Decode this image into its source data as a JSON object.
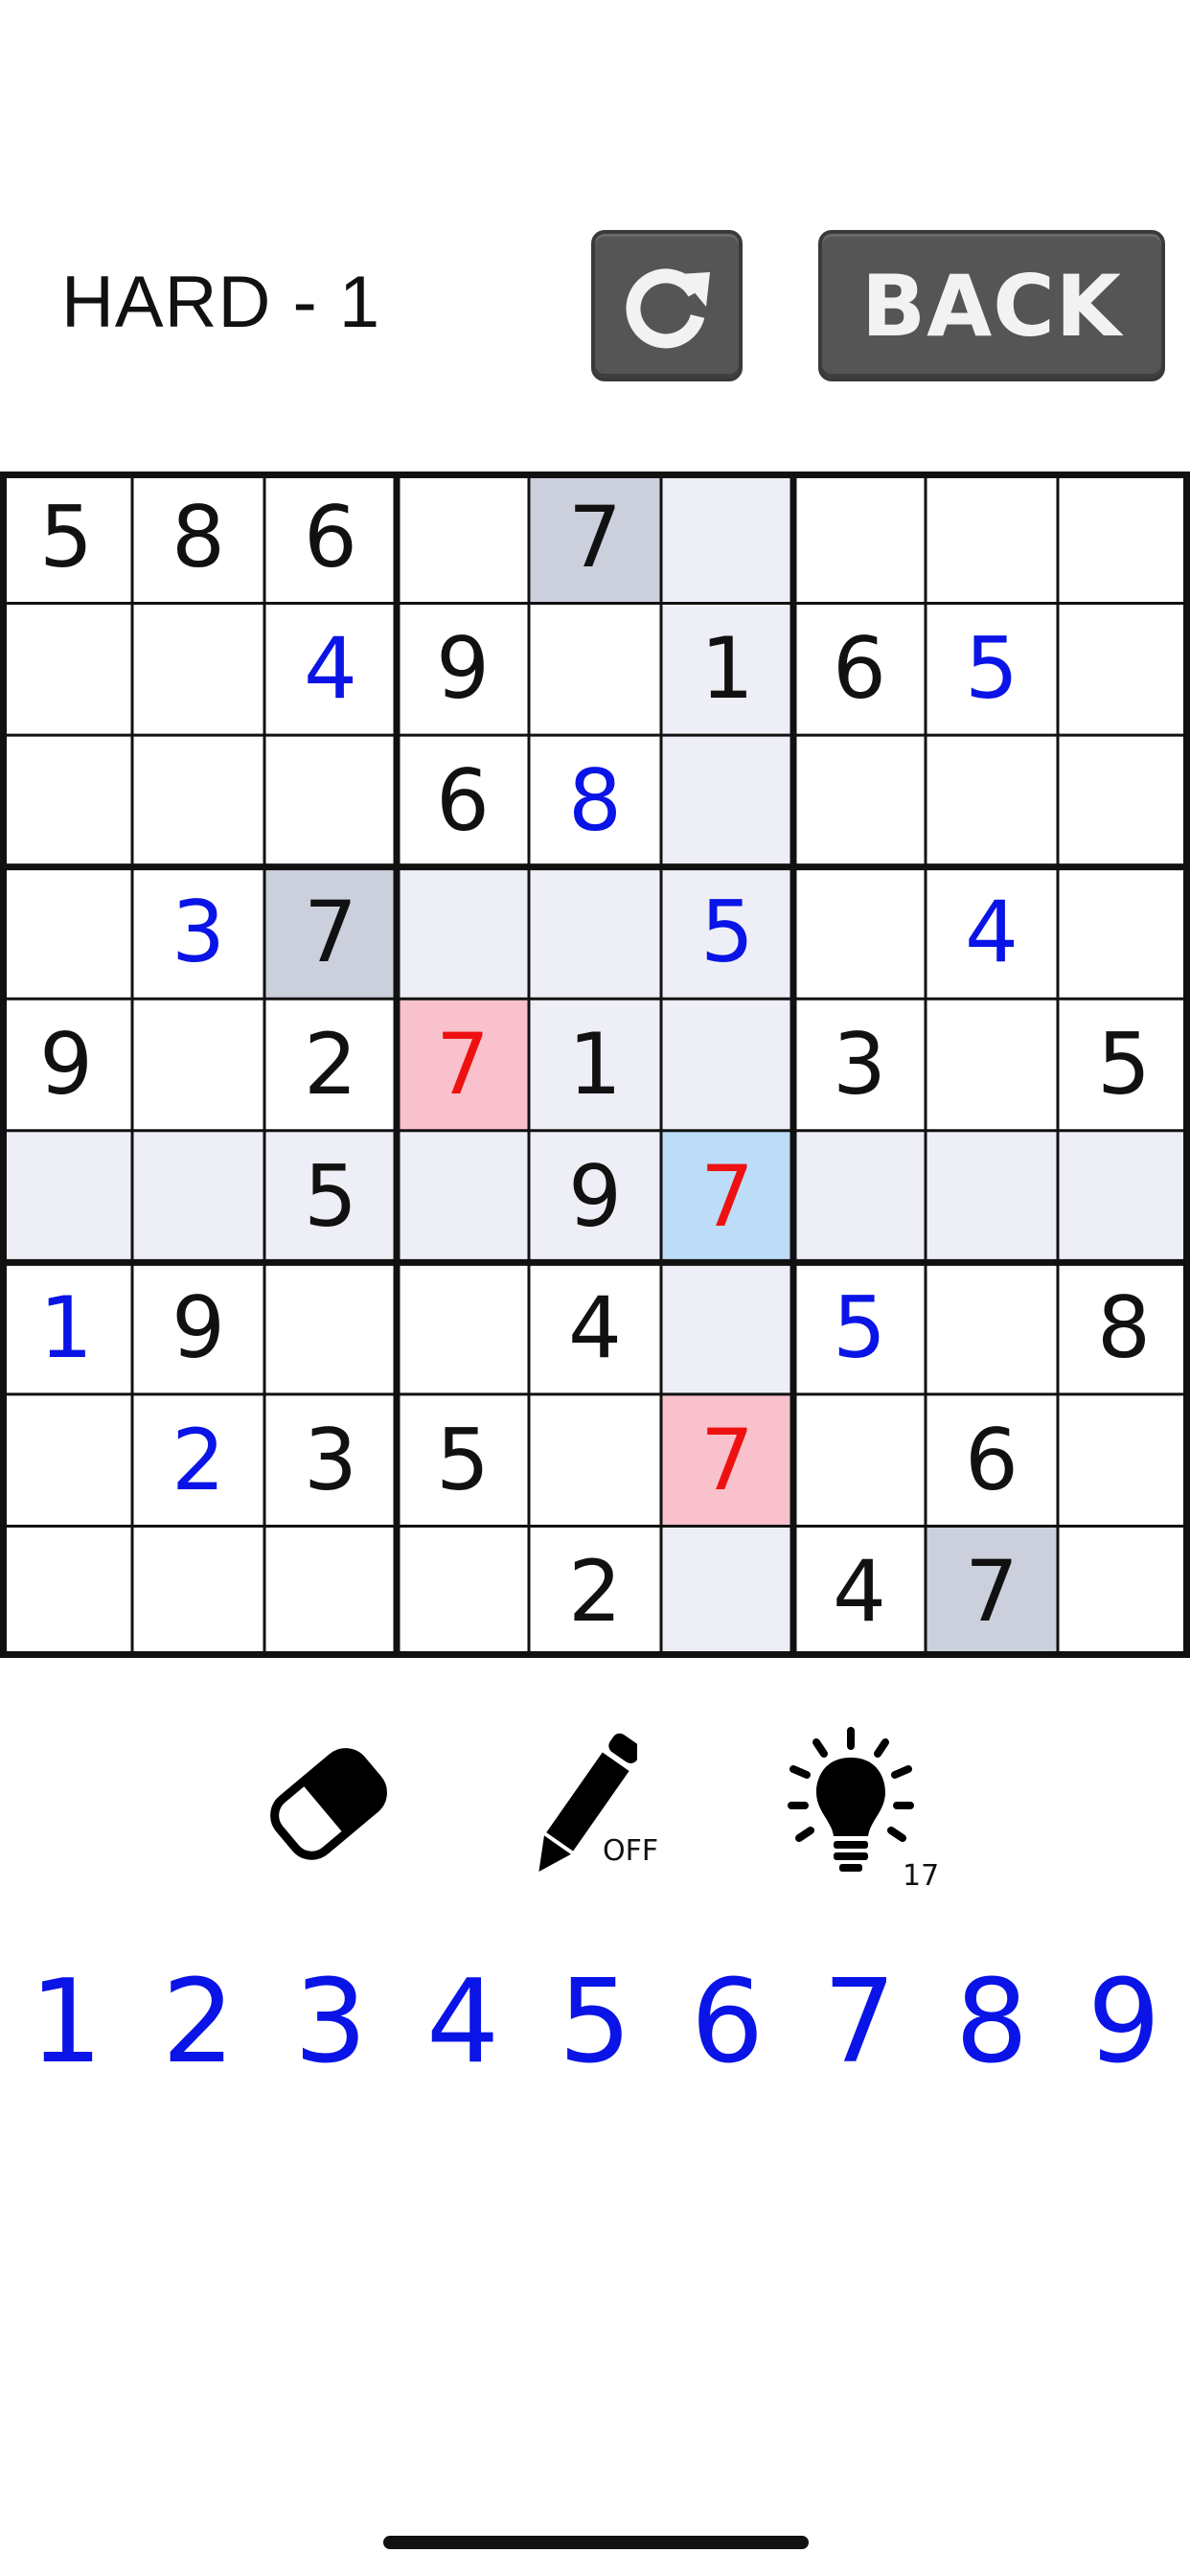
{
  "header": {
    "title": "HARD - 1",
    "back_label": "BACK",
    "reset_icon": "refresh-icon"
  },
  "colors": {
    "given": "#111111",
    "entered": "#0a14e6",
    "error": "#ee1111",
    "numpad": "#0a14e6",
    "highlight_line": "#eeeff6",
    "highlight_same": "#ccd0dc",
    "highlight_error": "#f9c1cc",
    "highlight_selected": "#bcdcf8",
    "button": "#555555"
  },
  "board": {
    "selected": [
      5,
      5
    ],
    "cells": [
      [
        {
          "v": "5",
          "t": "given"
        },
        {
          "v": "8",
          "t": "given"
        },
        {
          "v": "6",
          "t": "given"
        },
        {
          "v": "",
          "t": ""
        },
        {
          "v": "7",
          "t": "given"
        },
        {
          "v": "",
          "t": ""
        },
        {
          "v": "",
          "t": ""
        },
        {
          "v": "",
          "t": ""
        },
        {
          "v": "",
          "t": ""
        }
      ],
      [
        {
          "v": "",
          "t": ""
        },
        {
          "v": "",
          "t": ""
        },
        {
          "v": "4",
          "t": "entered"
        },
        {
          "v": "9",
          "t": "given"
        },
        {
          "v": "",
          "t": ""
        },
        {
          "v": "1",
          "t": "given"
        },
        {
          "v": "6",
          "t": "given"
        },
        {
          "v": "5",
          "t": "entered"
        },
        {
          "v": "",
          "t": ""
        }
      ],
      [
        {
          "v": "",
          "t": ""
        },
        {
          "v": "",
          "t": ""
        },
        {
          "v": "",
          "t": ""
        },
        {
          "v": "6",
          "t": "given"
        },
        {
          "v": "8",
          "t": "entered"
        },
        {
          "v": "",
          "t": ""
        },
        {
          "v": "",
          "t": ""
        },
        {
          "v": "",
          "t": ""
        },
        {
          "v": "",
          "t": ""
        }
      ],
      [
        {
          "v": "",
          "t": ""
        },
        {
          "v": "3",
          "t": "entered"
        },
        {
          "v": "7",
          "t": "given"
        },
        {
          "v": "",
          "t": ""
        },
        {
          "v": "",
          "t": ""
        },
        {
          "v": "5",
          "t": "entered"
        },
        {
          "v": "",
          "t": ""
        },
        {
          "v": "4",
          "t": "entered"
        },
        {
          "v": "",
          "t": ""
        }
      ],
      [
        {
          "v": "9",
          "t": "given"
        },
        {
          "v": "",
          "t": ""
        },
        {
          "v": "2",
          "t": "given"
        },
        {
          "v": "7",
          "t": "error"
        },
        {
          "v": "1",
          "t": "given"
        },
        {
          "v": "",
          "t": ""
        },
        {
          "v": "3",
          "t": "given"
        },
        {
          "v": "",
          "t": ""
        },
        {
          "v": "5",
          "t": "given"
        }
      ],
      [
        {
          "v": "",
          "t": ""
        },
        {
          "v": "",
          "t": ""
        },
        {
          "v": "5",
          "t": "given"
        },
        {
          "v": "",
          "t": ""
        },
        {
          "v": "9",
          "t": "given"
        },
        {
          "v": "7",
          "t": "error"
        },
        {
          "v": "",
          "t": ""
        },
        {
          "v": "",
          "t": ""
        },
        {
          "v": "",
          "t": ""
        }
      ],
      [
        {
          "v": "1",
          "t": "entered"
        },
        {
          "v": "9",
          "t": "given"
        },
        {
          "v": "",
          "t": ""
        },
        {
          "v": "",
          "t": ""
        },
        {
          "v": "4",
          "t": "given"
        },
        {
          "v": "",
          "t": ""
        },
        {
          "v": "5",
          "t": "entered"
        },
        {
          "v": "",
          "t": ""
        },
        {
          "v": "8",
          "t": "given"
        }
      ],
      [
        {
          "v": "",
          "t": ""
        },
        {
          "v": "2",
          "t": "entered"
        },
        {
          "v": "3",
          "t": "given"
        },
        {
          "v": "5",
          "t": "given"
        },
        {
          "v": "",
          "t": ""
        },
        {
          "v": "7",
          "t": "error"
        },
        {
          "v": "",
          "t": ""
        },
        {
          "v": "6",
          "t": "given"
        },
        {
          "v": "",
          "t": ""
        }
      ],
      [
        {
          "v": "",
          "t": ""
        },
        {
          "v": "",
          "t": ""
        },
        {
          "v": "",
          "t": ""
        },
        {
          "v": "",
          "t": ""
        },
        {
          "v": "2",
          "t": "given"
        },
        {
          "v": "",
          "t": ""
        },
        {
          "v": "4",
          "t": "given"
        },
        {
          "v": "7",
          "t": "given"
        },
        {
          "v": "",
          "t": ""
        }
      ]
    ],
    "highlights": {
      "same": [
        [
          0,
          4
        ],
        [
          3,
          2
        ],
        [
          8,
          7
        ]
      ],
      "error": [
        [
          4,
          3
        ],
        [
          7,
          5
        ]
      ]
    }
  },
  "tools": {
    "eraser_icon": "eraser-icon",
    "pencil_icon": "pencil-icon",
    "pencil_state": "OFF",
    "hint_icon": "lightbulb-icon",
    "hint_count": "17"
  },
  "numpad": [
    "1",
    "2",
    "3",
    "4",
    "5",
    "6",
    "7",
    "8",
    "9"
  ]
}
